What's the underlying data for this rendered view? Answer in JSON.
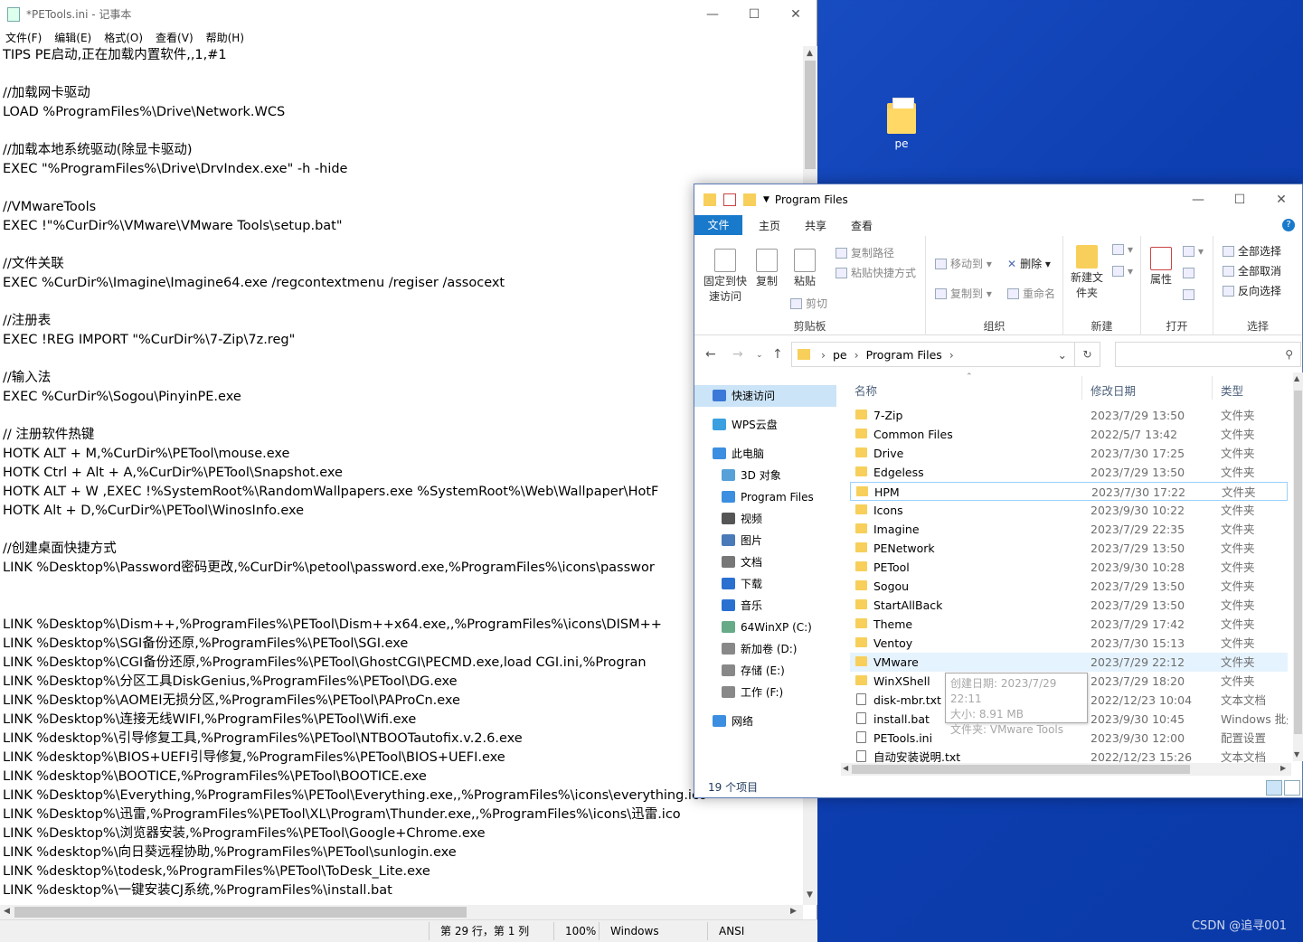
{
  "desktop": {
    "icon_label": "pe",
    "watermark": "CSDN @追寻001"
  },
  "notepad": {
    "title": "*PETools.ini - 记事本",
    "menu": [
      "文件(F)",
      "编辑(E)",
      "格式(O)",
      "查看(V)",
      "帮助(H)"
    ],
    "lines": [
      "TIPS PE启动,正在加载内置软件,,1,#1",
      "",
      "//加载网卡驱动",
      "LOAD %ProgramFiles%\\Drive\\Network.WCS",
      "",
      "//加载本地系统驱动(除显卡驱动)",
      "EXEC \"%ProgramFiles%\\Drive\\DrvIndex.exe\" -h -hide",
      "",
      "//VMwareTools",
      "EXEC !\"%CurDir%\\VMware\\VMware Tools\\setup.bat\"",
      "",
      "//文件关联",
      "EXEC %CurDir%\\Imagine\\Imagine64.exe /regcontextmenu /regiser /assocext",
      "",
      "//注册表",
      "EXEC !REG IMPORT \"%CurDir%\\7-Zip\\7z.reg\"",
      "",
      "//输入法",
      "EXEC %CurDir%\\Sogou\\PinyinPE.exe",
      "",
      "// 注册软件热键",
      "HOTK ALT + M,%CurDir%\\PETool\\mouse.exe",
      "HOTK Ctrl + Alt + A,%CurDir%\\PETool\\Snapshot.exe",
      "HOTK ALT + W ,EXEC !%SystemRoot%\\RandomWallpapers.exe %SystemRoot%\\Web\\Wallpaper\\HotF",
      "HOTK Alt + D,%CurDir%\\PETool\\WinosInfo.exe",
      "",
      "//创建桌面快捷方式",
      "LINK %Desktop%\\Password密码更改,%CurDir%\\petool\\password.exe,%ProgramFiles%\\icons\\passwor",
      "",
      "",
      "LINK %Desktop%\\Dism++,%ProgramFiles%\\PETool\\Dism++x64.exe,,%ProgramFiles%\\icons\\DISM++",
      "LINK %Desktop%\\SGI备份还原,%ProgramFiles%\\PETool\\SGI.exe",
      "LINK %Desktop%\\CGI备份还原,%ProgramFiles%\\PETool\\GhostCGI\\PECMD.exe,load CGI.ini,%Progran",
      "LINK %Desktop%\\分区工具DiskGenius,%ProgramFiles%\\PETool\\DG.exe",
      "LINK %Desktop%\\AOMEI无损分区,%ProgramFiles%\\PETool\\PAProCn.exe",
      "LINK %Desktop%\\连接无线WIFI,%ProgramFiles%\\PETool\\Wifi.exe",
      "LINK %desktop%\\引导修复工具,%ProgramFiles%\\PETool\\NTBOOTautofix.v.2.6.exe",
      "LINK %desktop%\\BIOS+UEFI引导修复,%ProgramFiles%\\PETool\\BIOS+UEFI.exe",
      "LINK %desktop%\\BOOTICE,%ProgramFiles%\\PETool\\BOOTICE.exe",
      "LINK %Desktop%\\Everything,%ProgramFiles%\\PETool\\Everything.exe,,%ProgramFiles%\\icons\\everything.ico",
      "LINK %Desktop%\\迅雷,%ProgramFiles%\\PETool\\XL\\Program\\Thunder.exe,,%ProgramFiles%\\icons\\迅雷.ico",
      "LINK %Desktop%\\浏览器安装,%ProgramFiles%\\PETool\\Google+Chrome.exe",
      "LINK %desktop%\\向日葵远程协助,%ProgramFiles%\\PETool\\sunlogin.exe",
      "LINK %desktop%\\todesk,%ProgramFiles%\\PETool\\ToDesk_Lite.exe",
      "LINK %desktop%\\一键安装CJ系统,%ProgramFiles%\\install.bat"
    ],
    "status": {
      "pos": "第 29 行，第 1 列",
      "zoom": "100%",
      "eol": "Windows (CRLF)",
      "enc": "ANSI"
    }
  },
  "explorer": {
    "title": "Program Files",
    "tabs": {
      "file": "文件",
      "home": "主页",
      "share": "共享",
      "view": "查看"
    },
    "ribbon": {
      "pin": "固定到快速访问",
      "copy": "复制",
      "paste": "粘贴",
      "copy_path": "复制路径",
      "paste_shortcut": "粘贴快捷方式",
      "cut": "剪切",
      "clipboard": "剪贴板",
      "move_to": "移动到",
      "copy_to": "复制到",
      "delete": "删除",
      "rename": "重命名",
      "organize": "组织",
      "new_folder": "新建文件夹",
      "new": "新建",
      "properties": "属性",
      "open": "打开",
      "select_all": "全部选择",
      "select_none": "全部取消",
      "invert": "反向选择",
      "select": "选择"
    },
    "address": {
      "crumbs": [
        "pe",
        "Program Files"
      ]
    },
    "nav": [
      "快速访问",
      "WPS云盘",
      "此电脑",
      "3D 对象",
      "Program Files",
      "视频",
      "图片",
      "文档",
      "下载",
      "音乐",
      "64WinXP  (C:)",
      "新加卷 (D:)",
      "存储 (E:)",
      "工作 (F:)",
      "网络"
    ],
    "headers": {
      "name": "名称",
      "date": "修改日期",
      "type": "类型"
    },
    "files": [
      {
        "name": "7-Zip",
        "date": "2023/7/29 13:50",
        "type": "文件夹"
      },
      {
        "name": "Common Files",
        "date": "2022/5/7 13:42",
        "type": "文件夹"
      },
      {
        "name": "Drive",
        "date": "2023/7/30 17:25",
        "type": "文件夹"
      },
      {
        "name": "Edgeless",
        "date": "2023/7/29 13:50",
        "type": "文件夹"
      },
      {
        "name": "HPM",
        "date": "2023/7/30 17:22",
        "type": "文件夹"
      },
      {
        "name": "Icons",
        "date": "2023/9/30 10:22",
        "type": "文件夹"
      },
      {
        "name": "Imagine",
        "date": "2023/7/29 22:35",
        "type": "文件夹"
      },
      {
        "name": "PENetwork",
        "date": "2023/7/29 13:50",
        "type": "文件夹"
      },
      {
        "name": "PETool",
        "date": "2023/9/30 10:28",
        "type": "文件夹"
      },
      {
        "name": "Sogou",
        "date": "2023/7/29 13:50",
        "type": "文件夹"
      },
      {
        "name": "StartAllBack",
        "date": "2023/7/29 13:50",
        "type": "文件夹"
      },
      {
        "name": "Theme",
        "date": "2023/7/29 17:42",
        "type": "文件夹"
      },
      {
        "name": "Ventoy",
        "date": "2023/7/30 15:13",
        "type": "文件夹"
      },
      {
        "name": "VMware",
        "date": "2023/7/29 22:12",
        "type": "文件夹"
      },
      {
        "name": "WinXShell",
        "date": "2023/7/29 18:20",
        "type": "文件夹"
      },
      {
        "name": "disk-mbr.txt",
        "date": "2022/12/23 10:04",
        "type": "文本文档"
      },
      {
        "name": "install.bat",
        "date": "2023/9/30 10:45",
        "type": "Windows 批处"
      },
      {
        "name": "PETools.ini",
        "date": "2023/9/30 12:00",
        "type": "配置设置"
      },
      {
        "name": "自动安装说明.txt",
        "date": "2022/12/23 15:26",
        "type": "文本文档"
      }
    ],
    "tooltip": {
      "created": "创建日期: 2023/7/29 22:11",
      "size": "大小: 8.91 MB",
      "folders": "文件夹: VMware Tools"
    },
    "status": "19 个项目"
  }
}
